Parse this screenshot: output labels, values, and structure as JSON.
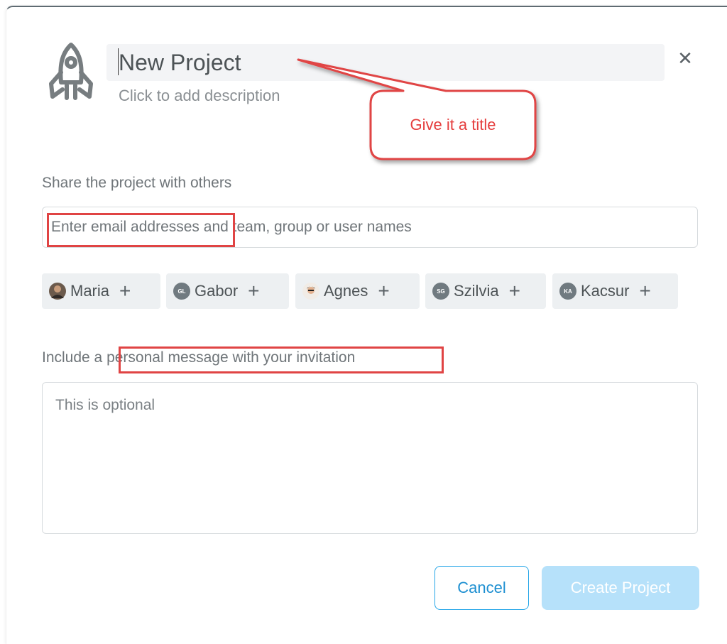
{
  "project": {
    "title": "New Project",
    "description_placeholder": "Click to add description",
    "icon": "rocket-icon"
  },
  "annotation": {
    "callout_text": "Give it a title"
  },
  "share": {
    "label": "Share the project with others",
    "input_placeholder": "Enter email addresses and team, group or user names"
  },
  "suggested_users": [
    {
      "name": "Maria",
      "avatar": "photo",
      "initials": ""
    },
    {
      "name": "Gabor",
      "avatar": "initials",
      "initials": "GL"
    },
    {
      "name": "Agnes",
      "avatar": "photo",
      "initials": ""
    },
    {
      "name": "Szilvia",
      "avatar": "initials",
      "initials": "SG"
    },
    {
      "name": "Kacsur",
      "avatar": "initials",
      "initials": "KA"
    }
  ],
  "message": {
    "label": "Include a personal message with your invitation",
    "placeholder": "This is optional"
  },
  "buttons": {
    "cancel": "Cancel",
    "create": "Create Project"
  },
  "colors": {
    "accent": "#26a6e8",
    "create_disabled": "#b6e1fa",
    "annotation_red": "#e04444"
  }
}
